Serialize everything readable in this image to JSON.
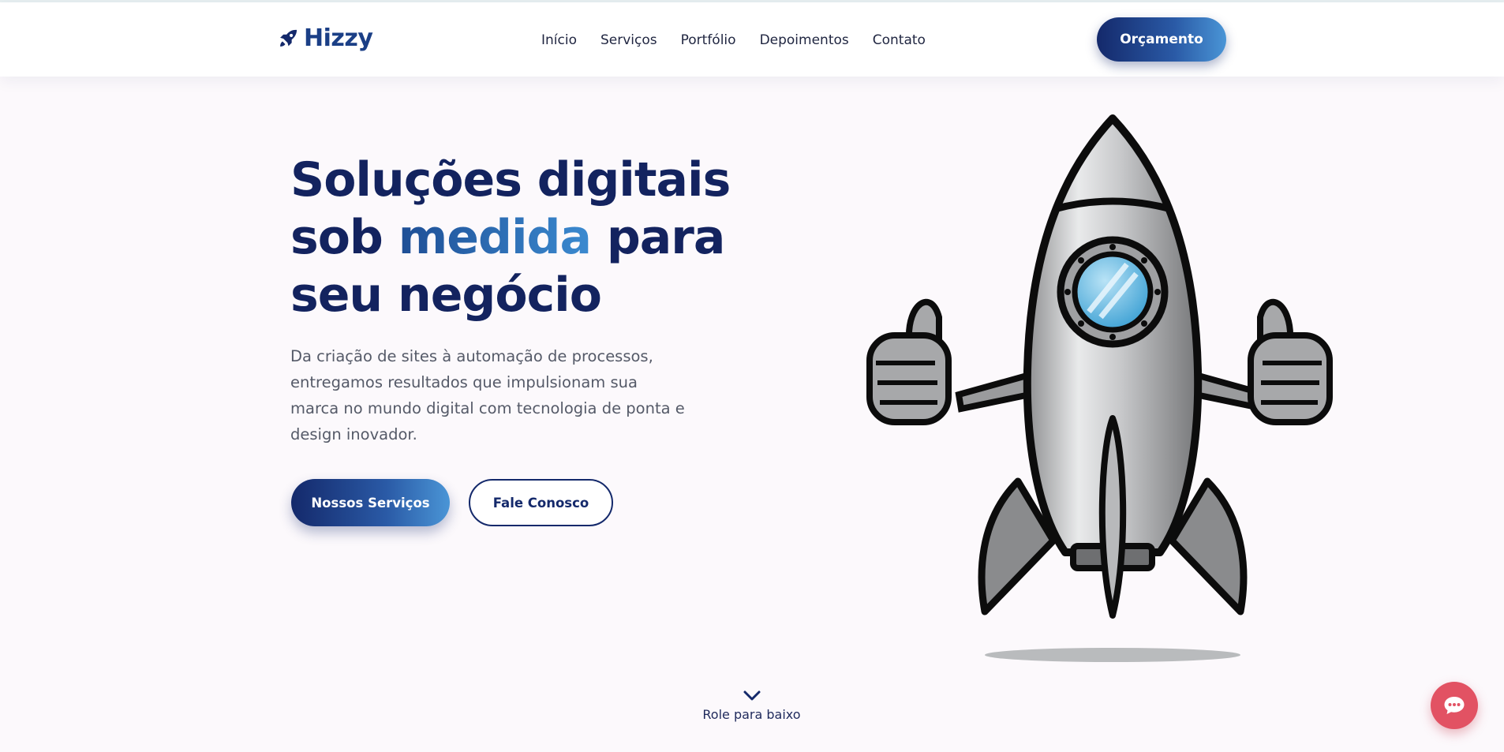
{
  "brand": {
    "name": "Hizzy",
    "logo_icon": "rocket-icon",
    "primary_color": "#14296b",
    "accent_color": "#3b8ad0"
  },
  "nav": {
    "items": [
      {
        "label": "Início"
      },
      {
        "label": "Serviços"
      },
      {
        "label": "Portfólio"
      },
      {
        "label": "Depoimentos"
      },
      {
        "label": "Contato"
      }
    ],
    "cta_label": "Orçamento"
  },
  "hero": {
    "title_part1": "Soluções digitais sob ",
    "title_accent": "medida",
    "title_part2": " para seu negócio",
    "subtitle": "Da criação de sites à automação de processos, entregamos resultados que impulsionam sua marca no mundo digital com tecnologia de ponta e design inovador.",
    "primary_button": "Nossos Serviços",
    "secondary_button": "Fale Conosco",
    "illustration": "rocket-thumbs-up-illustration"
  },
  "scroll_hint": {
    "label": "Role para baixo",
    "icon": "chevron-down-icon"
  },
  "chat_widget": {
    "icon": "chat-bubble-icon",
    "color": "#e25263"
  }
}
